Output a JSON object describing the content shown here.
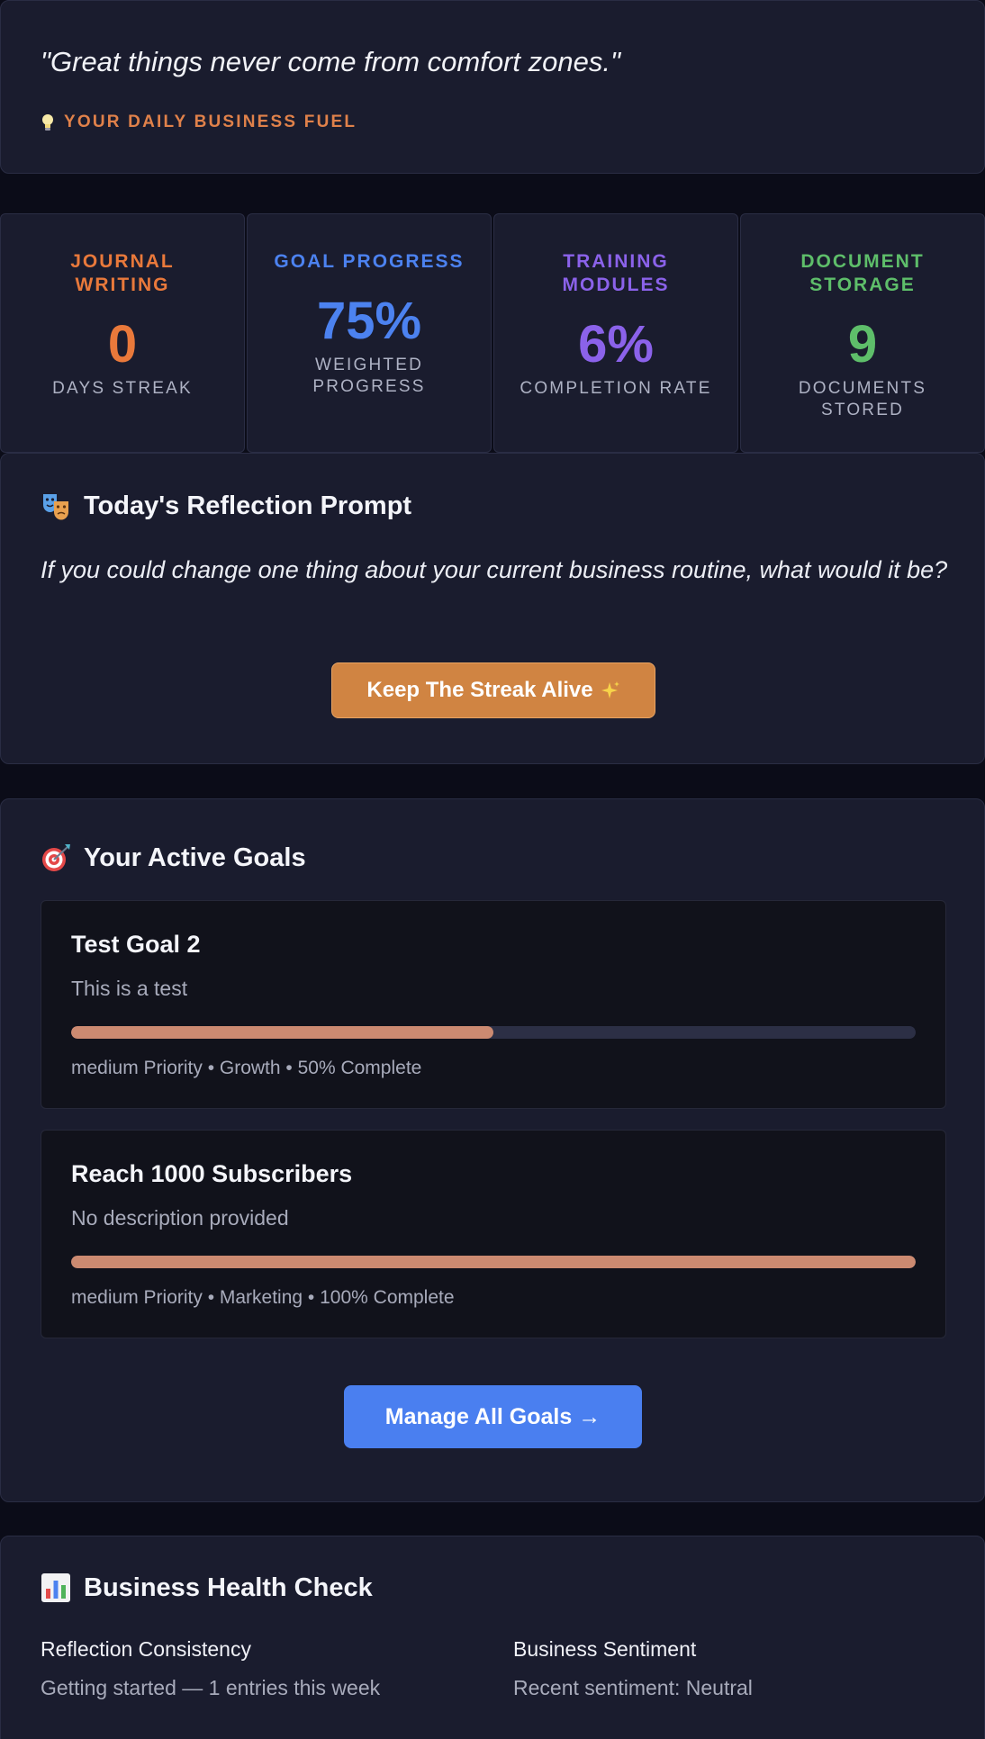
{
  "quote": {
    "text": "\"Great things never come from comfort zones.\"",
    "tagline": "YOUR DAILY BUSINESS FUEL",
    "icon": "lightbulb-icon"
  },
  "stats": [
    {
      "label": "JOURNAL WRITING",
      "value": "0",
      "sub": "DAYS STREAK",
      "color": "#e9793b"
    },
    {
      "label": "GOAL PROGRESS",
      "value": "75%",
      "sub": "WEIGHTED PROGRESS",
      "color": "#4c82f0"
    },
    {
      "label": "TRAINING MODULES",
      "value": "6%",
      "sub": "COMPLETION RATE",
      "color": "#8b62ea"
    },
    {
      "label": "DOCUMENT STORAGE",
      "value": "9",
      "sub": "DOCUMENTS STORED",
      "color": "#5ebe6a"
    }
  ],
  "reflection": {
    "title": "Today's Reflection Prompt",
    "icon": "theater-masks-icon",
    "prompt": "If you could change one thing about your current business routine, what would it be?",
    "button_label": "Keep The Streak Alive",
    "button_icon": "sparkles-icon"
  },
  "goals": {
    "title": "Your Active Goals",
    "icon": "target-icon",
    "items": [
      {
        "title": "Test Goal 2",
        "description": "This is a test",
        "progress": 50,
        "meta": "medium Priority • Growth • 50% Complete"
      },
      {
        "title": "Reach 1000 Subscribers",
        "description": "No description provided",
        "progress": 100,
        "meta": "medium Priority • Marketing • 100% Complete"
      }
    ],
    "manage_label": "Manage All Goals →"
  },
  "health": {
    "title": "Business Health Check",
    "icon": "bar-chart-icon",
    "metrics": [
      {
        "label": "Reflection Consistency",
        "value": "Getting started — 1 entries this week"
      },
      {
        "label": "Business Sentiment",
        "value": "Recent sentiment: Neutral"
      }
    ]
  }
}
